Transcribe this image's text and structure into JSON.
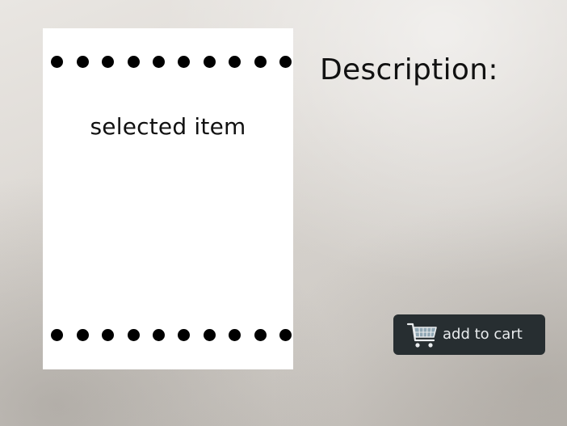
{
  "product_card": {
    "label": "selected item"
  },
  "details": {
    "description_label": "Description:"
  },
  "actions": {
    "add_to_cart_label": "add to cart",
    "icon": "shopping-cart-icon"
  },
  "colors": {
    "card_background": "#ffffff",
    "button_background": "#272e31",
    "button_text": "#e9ecee"
  }
}
